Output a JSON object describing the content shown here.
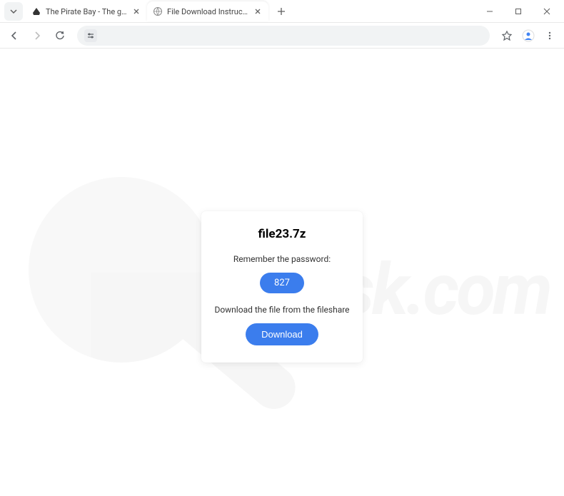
{
  "tabs": [
    {
      "title": "The Pirate Bay - The galaxy's m",
      "active": false
    },
    {
      "title": "File Download Instructions for f",
      "active": true
    }
  ],
  "card": {
    "filename": "file23.7z",
    "password_label": "Remember the password:",
    "password_value": "827",
    "download_text": "Download the file from the fileshare",
    "download_button": "Download"
  },
  "watermark_text": "risk.com"
}
